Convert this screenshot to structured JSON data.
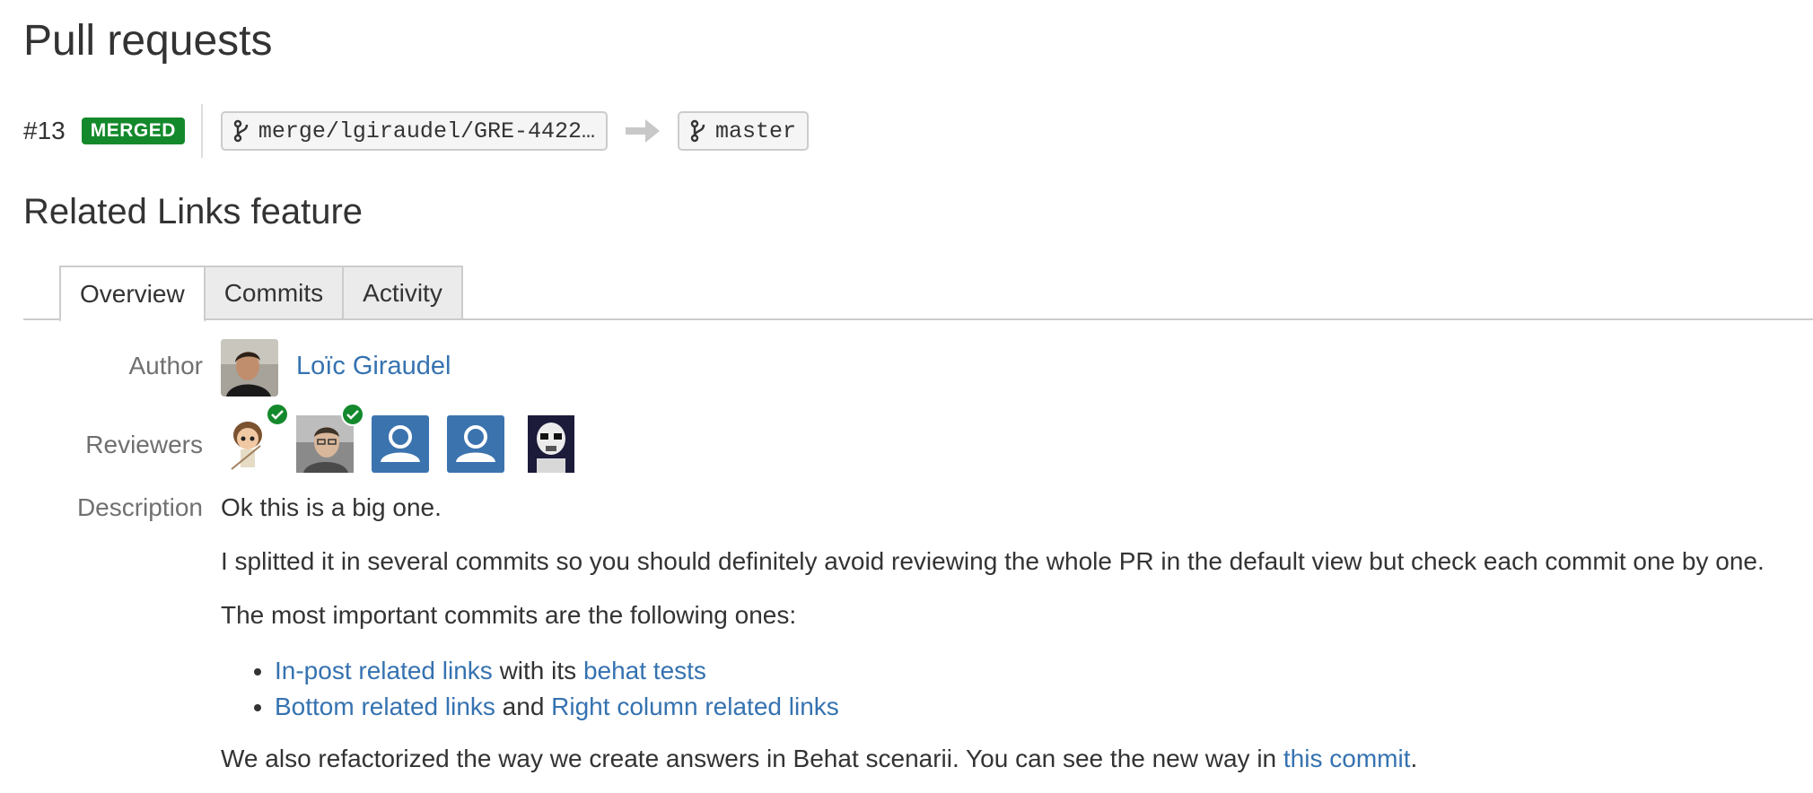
{
  "page": {
    "heading": "Pull requests"
  },
  "pr": {
    "number": "#13",
    "status": "MERGED",
    "source_branch": "merge/lgiraudel/GRE-4422…",
    "target_branch": "master",
    "title": "Related Links feature"
  },
  "tabs": [
    {
      "label": "Overview",
      "active": true
    },
    {
      "label": "Commits",
      "active": false
    },
    {
      "label": "Activity",
      "active": false
    }
  ],
  "author": {
    "label": "Author",
    "name": "Loïc Giraudel"
  },
  "reviewers": {
    "label": "Reviewers",
    "items": [
      {
        "avatar": "figure-avatar",
        "approved": true
      },
      {
        "avatar": "photo-avatar",
        "approved": true
      },
      {
        "avatar": "default-user-avatar",
        "approved": false
      },
      {
        "avatar": "default-user-avatar",
        "approved": false
      },
      {
        "avatar": "stormtrooper-avatar",
        "approved": false
      }
    ]
  },
  "description": {
    "label": "Description",
    "p1": "Ok this is a big one.",
    "p2": "I splitted it in several commits so you should definitely avoid reviewing the whole PR in the default view but check each commit one by one.",
    "p3": "The most important commits are the following ones:",
    "list": [
      {
        "link1": "In-post related links",
        "mid": "with its",
        "link2": "behat tests"
      },
      {
        "link1": "Bottom related links",
        "mid": "and",
        "link2": "Right column related links"
      }
    ],
    "p4_text": "We also refactorized the way we create answers in Behat scenarii. You can see the new way in",
    "p4_link": "this commit",
    "p4_end": "."
  },
  "colors": {
    "merged_badge": "#14892c",
    "link": "#3572b0",
    "default_avatar": "#3b73af"
  }
}
